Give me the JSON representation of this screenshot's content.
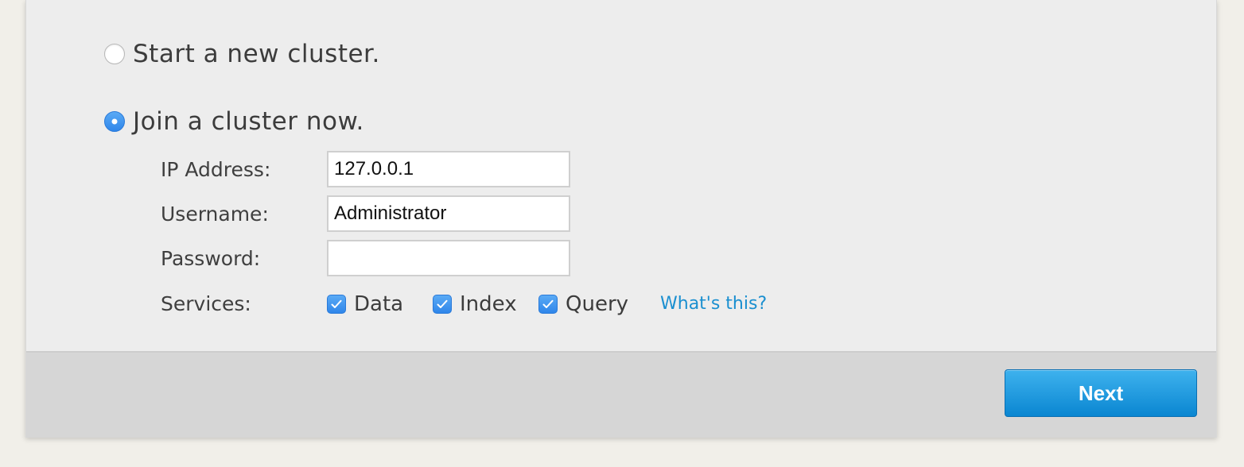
{
  "cluster_options": {
    "start_new": {
      "label": "Start a new cluster.",
      "selected": false
    },
    "join": {
      "label": "Join a cluster now.",
      "selected": true
    }
  },
  "join_form": {
    "ip_address": {
      "label": "IP Address:",
      "value": "127.0.0.1"
    },
    "username": {
      "label": "Username:",
      "value": "Administrator"
    },
    "password": {
      "label": "Password:",
      "value": ""
    },
    "services": {
      "label": "Services:",
      "items": [
        {
          "label": "Data",
          "checked": true
        },
        {
          "label": "Index",
          "checked": true
        },
        {
          "label": "Query",
          "checked": true
        }
      ],
      "help_link": "What's this?"
    }
  },
  "footer": {
    "next_label": "Next"
  },
  "colors": {
    "accent": "#2f86ea",
    "link": "#1a8fd0",
    "button": "#0a86d1",
    "panel_background": "#ededed",
    "footer_background": "#d6d6d6",
    "page_background": "#f1efe9"
  },
  "icons": {
    "checkbox_mark": "checkmark-icon"
  }
}
